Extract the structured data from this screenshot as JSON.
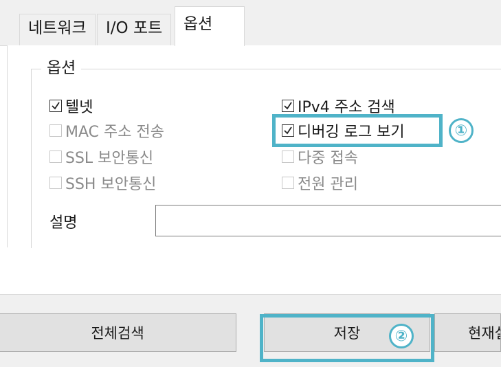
{
  "tabs": [
    {
      "label": "네트워크",
      "active": false
    },
    {
      "label": "I/O 포트",
      "active": false
    },
    {
      "label": "옵션",
      "active": true
    }
  ],
  "options_group": {
    "title": "옵션",
    "checkboxes": [
      {
        "label": "텔넷",
        "checked": true,
        "enabled": true
      },
      {
        "label": "IPv4 주소 검색",
        "checked": true,
        "enabled": true
      },
      {
        "label": "MAC 주소 전송",
        "checked": false,
        "enabled": false
      },
      {
        "label": "디버깅 로그 보기",
        "checked": true,
        "enabled": true
      },
      {
        "label": "SSL 보안통신",
        "checked": false,
        "enabled": false
      },
      {
        "label": "다중 접속",
        "checked": false,
        "enabled": false
      },
      {
        "label": "SSH 보안통신",
        "checked": false,
        "enabled": false
      },
      {
        "label": "전원 관리",
        "checked": false,
        "enabled": false
      }
    ],
    "description_label": "설명",
    "description_value": ""
  },
  "buttons": {
    "search_all": "전체검색",
    "save": "저장",
    "current": "현재설"
  },
  "annotations": {
    "badge1": "①",
    "badge2": "②",
    "highlight_color": "#4fb3c8"
  }
}
